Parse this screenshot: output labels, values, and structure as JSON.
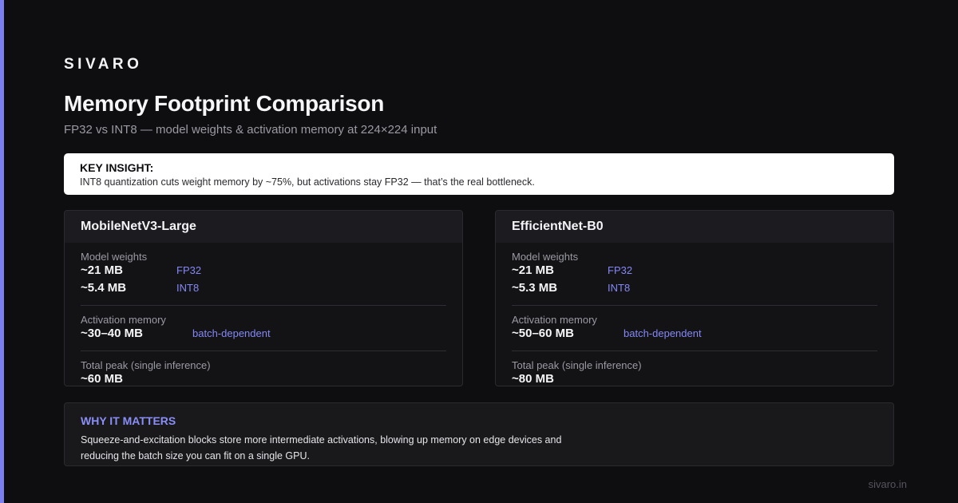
{
  "brand": "SIVARO",
  "title": "Memory Footprint Comparison",
  "subtitle": "FP32 vs INT8 — model weights & activation memory at 224×224 input",
  "insight": {
    "label": "KEY INSIGHT:",
    "text": "INT8 quantization cuts weight memory by ~75%, but activations stay FP32 — that’s the real bottleneck."
  },
  "cards": [
    {
      "title": "MobileNetV3-Large",
      "weights_label": "Model weights",
      "weights": [
        {
          "value": "~21 MB",
          "tag": "FP32"
        },
        {
          "value": "~5.4 MB",
          "tag": "INT8"
        }
      ],
      "activation_label": "Activation memory",
      "activation_value": "~30–40 MB",
      "activation_tag": "batch-dependent",
      "peak_label": "Total peak (single inference)",
      "peak_value": "~60 MB"
    },
    {
      "title": "EfficientNet-B0",
      "weights_label": "Model weights",
      "weights": [
        {
          "value": "~21 MB",
          "tag": "FP32"
        },
        {
          "value": "~5.3 MB",
          "tag": "INT8"
        }
      ],
      "activation_label": "Activation memory",
      "activation_value": "~50–60 MB",
      "activation_tag": "batch-dependent",
      "peak_label": "Total peak (single inference)",
      "peak_value": "~80 MB"
    }
  ],
  "why": {
    "label": "WHY IT MATTERS",
    "text": "Squeeze-and-excitation blocks store more intermediate activations, blowing up memory on edge devices and reducing the batch size you can fit on a single GPU."
  },
  "footer": "sivaro.in",
  "colors": {
    "accent": "#7b7ff2",
    "background": "#0e0e10",
    "tag": "#8488f5"
  }
}
